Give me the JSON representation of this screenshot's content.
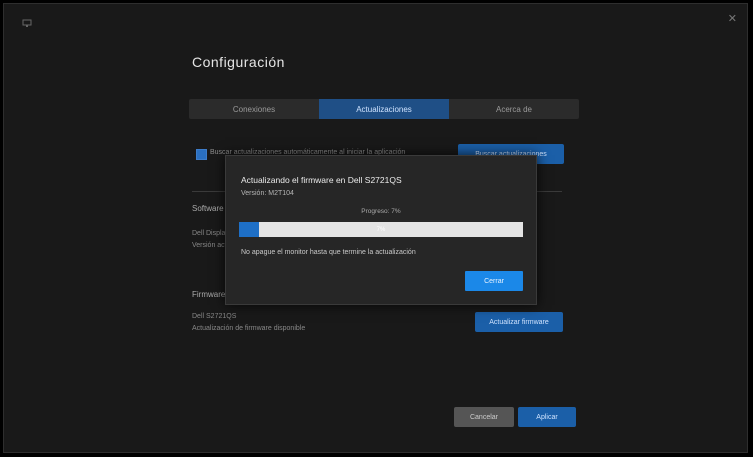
{
  "window": {
    "title": "Configuración",
    "tabs": [
      {
        "label": "Conexiones",
        "active": false
      },
      {
        "label": "Actualizaciones",
        "active": true
      },
      {
        "label": "Acerca de",
        "active": false
      }
    ],
    "checkbox_label": "Buscar actualizaciones automáticamente al iniciar la aplicación",
    "check_button": "Buscar actualizaciones",
    "section1_label": "Software",
    "section1_lines": [
      "Dell Display Manager",
      "Versión actual"
    ],
    "section2_label": "Firmware",
    "section2_lines": [
      "Dell S2721QS",
      "Actualización de firmware disponible"
    ],
    "update_button": "Actualizar firmware",
    "cancel_button": "Cancelar",
    "apply_button": "Aplicar"
  },
  "modal": {
    "title": "Actualizando el firmware en Dell S2721QS",
    "subtitle": "Versión: M2T104",
    "progress_label": "Progreso: 7%",
    "progress_percent": "7%",
    "progress_value": 0.07,
    "note": "No apague el monitor hasta que termine la actualización",
    "close_button": "Cerrar"
  },
  "colors": {
    "accent": "#1b88e8",
    "tab_active": "#1f4f86",
    "background": "#191919"
  }
}
